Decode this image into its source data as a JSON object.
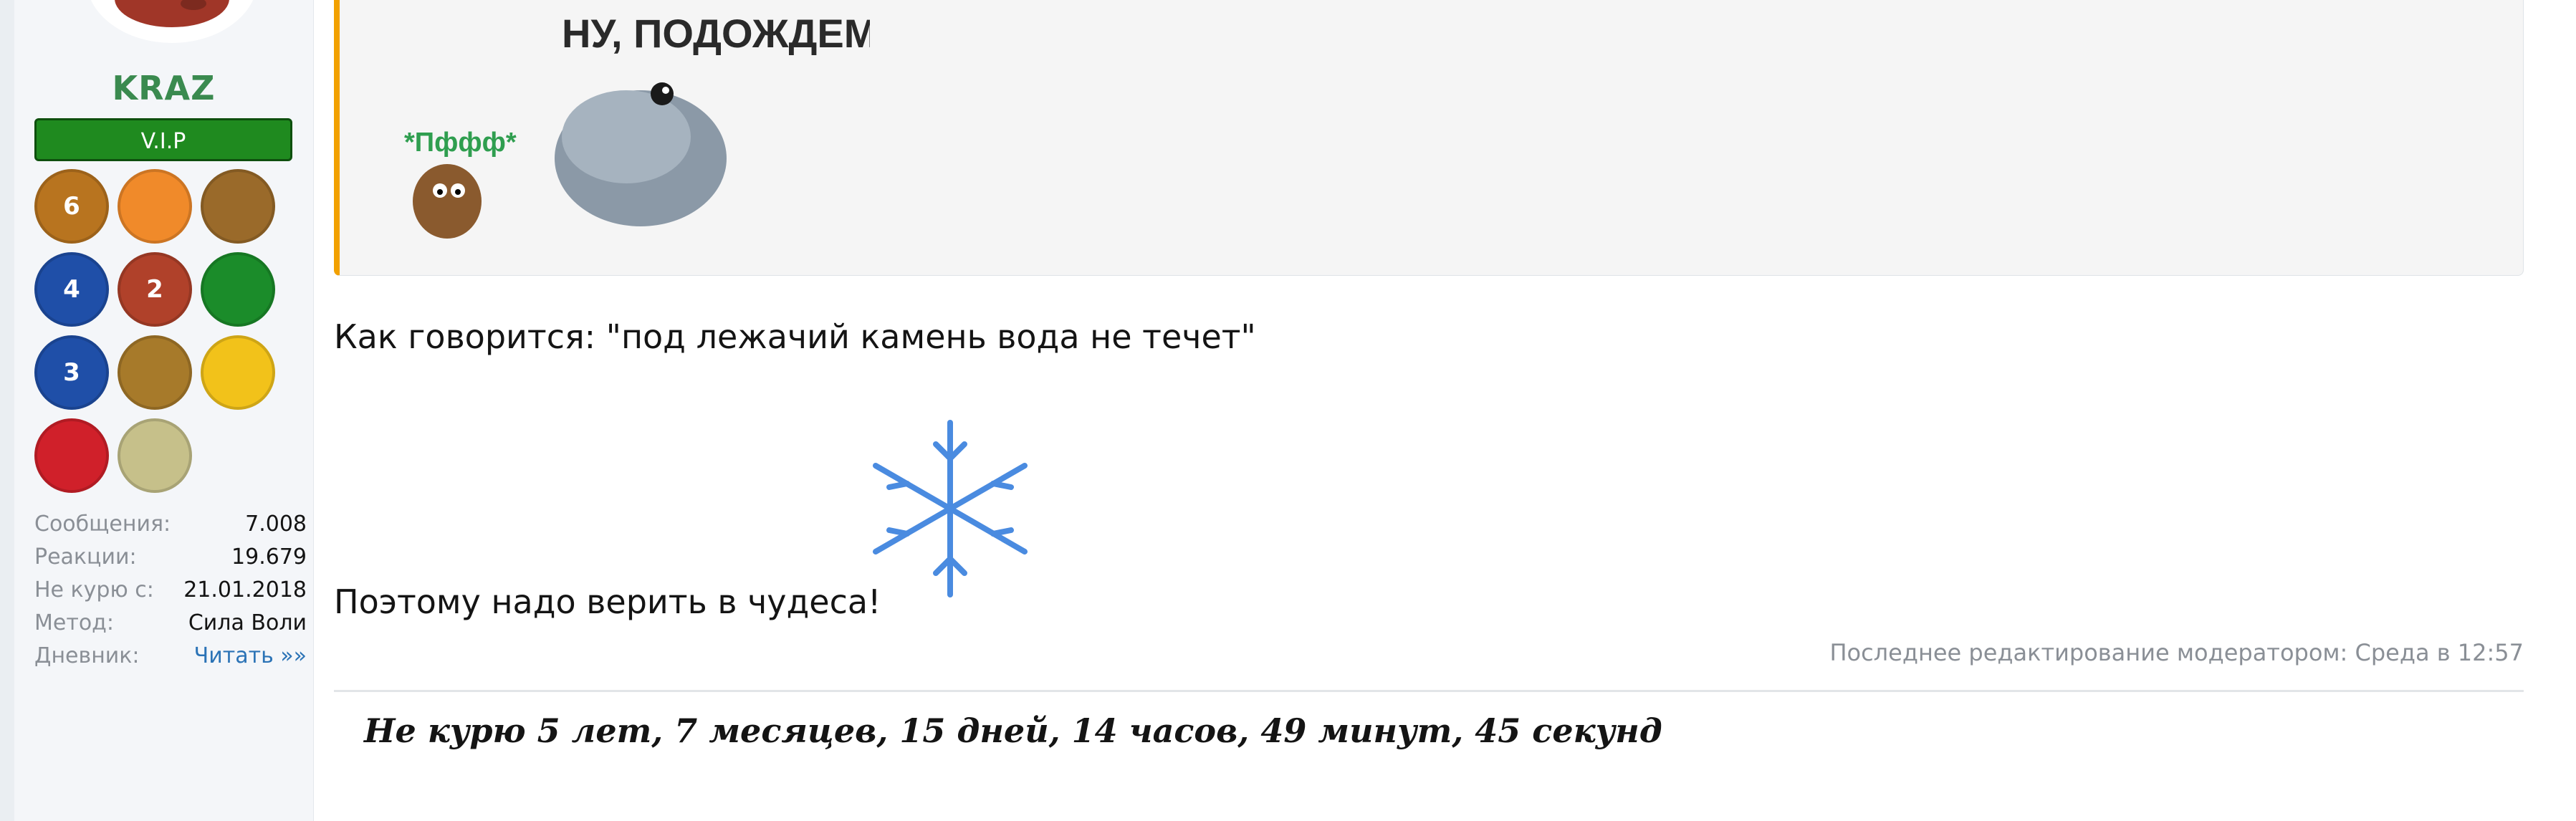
{
  "user": {
    "name": "KRAZ",
    "badge": "V.I.P",
    "trophies": [
      {
        "icon": "mountain-6-stars-icon",
        "label": "6",
        "color": "#b8741f"
      },
      {
        "icon": "people-circle-orange-icon",
        "label": "",
        "color": "#f08a2a"
      },
      {
        "icon": "laurel-stars-gold-icon",
        "label": "",
        "color": "#9a6a2a"
      },
      {
        "icon": "people-4-blue-icon",
        "label": "4",
        "color": "#1f4fa8"
      },
      {
        "icon": "suitcase-2-icon",
        "label": "2",
        "color": "#b0412a"
      },
      {
        "icon": "green-medal-people-icon",
        "label": "",
        "color": "#1b8c2a"
      },
      {
        "icon": "people-3-blue-icon",
        "label": "3",
        "color": "#1f4fa8"
      },
      {
        "icon": "book-stars-gold-icon",
        "label": "",
        "color": "#a77a2a"
      },
      {
        "icon": "medal-ribbon-icon",
        "label": "",
        "color": "#f2c21a"
      },
      {
        "icon": "no-alcohol-icon",
        "label": "",
        "color": "#d0202a"
      },
      {
        "icon": "cartoon-character-icon",
        "label": "",
        "color": "#c6c08a"
      }
    ],
    "stats": [
      {
        "key": "Сообщения:",
        "value": "7.008"
      },
      {
        "key": "Реакции:",
        "value": "19.679"
      },
      {
        "key": "Не курю с:",
        "value": "21.01.2018"
      },
      {
        "key": "Метод:",
        "value": "Сила Воли"
      },
      {
        "key": "Дневник:",
        "value": "Читать »»"
      }
    ]
  },
  "post": {
    "quote_sticker_caption": "НУ, ПОДОЖДЕМ...",
    "quote_sticker_small": "*Пффф*",
    "line1": "Как говорится: \"под лежачий камень вода не течет\"",
    "line2": "Поэтому надо верить в чудеса!",
    "edited_note": "Последнее редактирование модератором: Среда в 12:57",
    "signature": "Не курю  5 лет, 7 месяцев, 15 дней, 14 часов, 49 минут, 45 секунд"
  },
  "colors": {
    "username": "#3a8a4f",
    "vip_bg": "#1f8a1f",
    "quote_border": "#f2a100",
    "link": "#2b73b6",
    "muted": "#8a8f96"
  }
}
